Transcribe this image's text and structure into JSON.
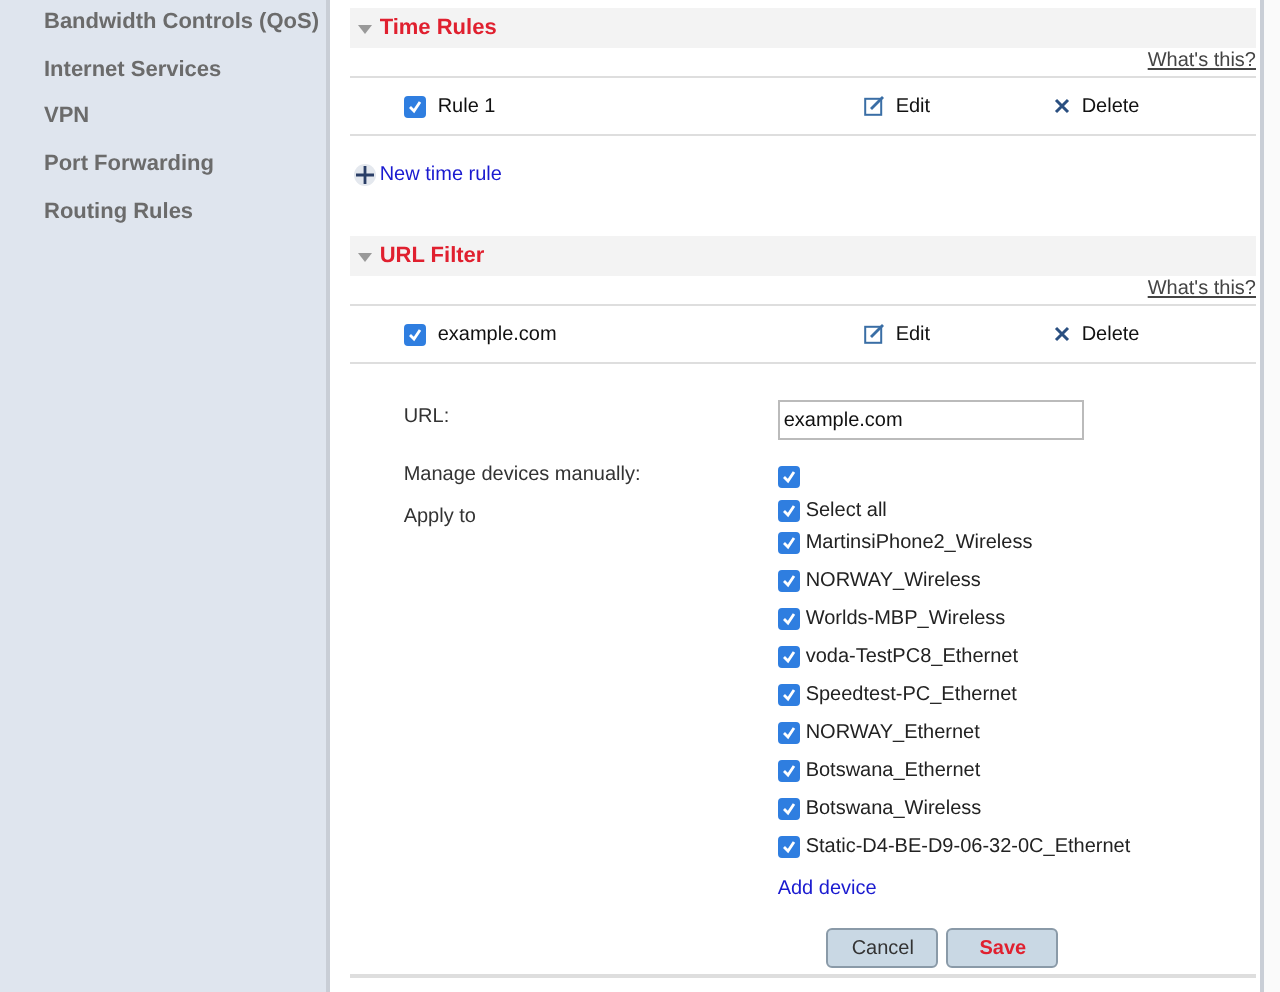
{
  "sidebar": {
    "items": [
      {
        "label": "Bandwidth Controls (QoS)",
        "selected": false
      },
      {
        "label": "Internet Services",
        "selected": false
      },
      {
        "label": "VPN",
        "selected": false
      },
      {
        "label": "Port Forwarding",
        "selected": false
      },
      {
        "label": "Routing Rules",
        "selected": false
      }
    ]
  },
  "time_rules": {
    "title": "Time Rules",
    "expanded": true,
    "help_link": "What's this?",
    "rules": [
      {
        "name": "Rule 1",
        "checked": true,
        "edit": "Edit",
        "delete": "Delete"
      }
    ],
    "add_link": "New time rule"
  },
  "url_filter": {
    "title": "URL Filter",
    "expanded": true,
    "help_link": "What's this?",
    "rules": [
      {
        "name": "example.com",
        "checked": true,
        "edit": "Edit",
        "delete": "Delete"
      }
    ],
    "url_label": "URL:",
    "url_value": "example.com",
    "manage_label": "Manage devices manually:",
    "manage_checked": true,
    "apply_label": "Apply to",
    "devices": [
      {
        "name": "Select all",
        "checked": true
      },
      {
        "name": "MartinsiPhone2_Wireless",
        "checked": true
      },
      {
        "name": "NORWAY_Wireless",
        "checked": true
      },
      {
        "name": "Worlds-MBP_Wireless",
        "checked": true
      },
      {
        "name": "voda-TestPC8_Ethernet",
        "checked": true
      },
      {
        "name": "Speedtest-PC_Ethernet",
        "checked": true
      },
      {
        "name": "NORWAY_Ethernet",
        "checked": true
      },
      {
        "name": "Botswana_Ethernet",
        "checked": true
      },
      {
        "name": "Botswana_Wireless",
        "checked": true
      },
      {
        "name": "Static-D4-BE-D9-06-32-0C_Ethernet",
        "checked": true
      }
    ],
    "add_device": "Add device",
    "buttons": [
      {
        "label": "Cancel",
        "kind": "cancel"
      },
      {
        "label": "Save",
        "kind": "save"
      }
    ]
  }
}
